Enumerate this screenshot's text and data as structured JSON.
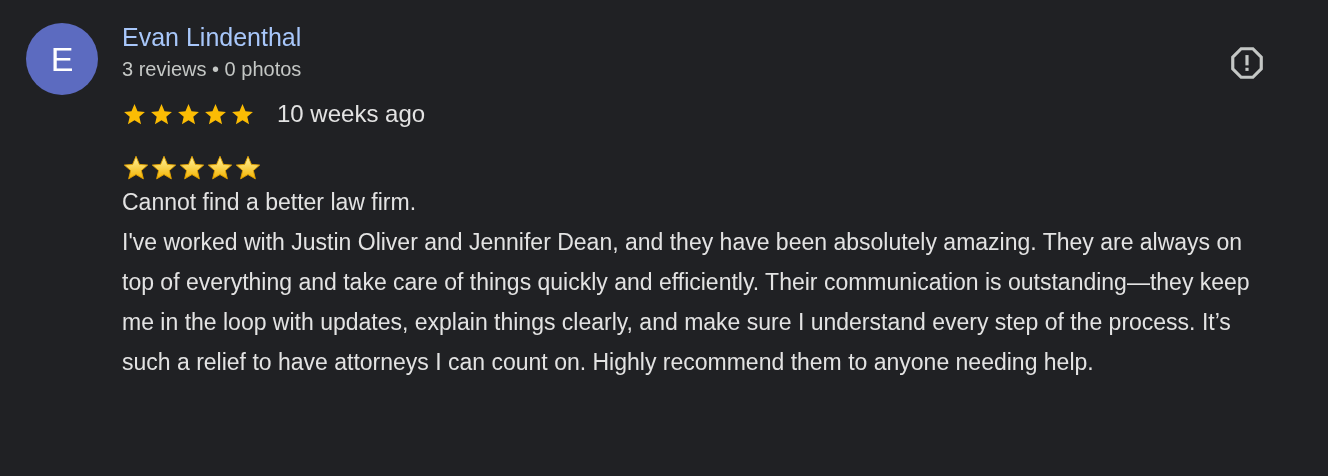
{
  "review": {
    "avatar_letter": "E",
    "author": "Evan Lindenthal",
    "author_meta": "3 reviews • 0 photos",
    "rating": {
      "stars": 5
    },
    "time": "10 weeks ago",
    "body_rating": {
      "stars": 5
    },
    "paragraphs": [
      "Cannot find a better law firm.",
      "I've worked with Justin Oliver and Jennifer Dean, and they have been absolutely amazing. They are always on top of everything and take care of things quickly and efficiently. Their communication is outstanding—they keep me in the loop with updates, explain things clearly, and make sure I understand every step of the process. It’s such a relief to have attorneys I can count on. Highly recommend them to anyone needing help."
    ]
  }
}
